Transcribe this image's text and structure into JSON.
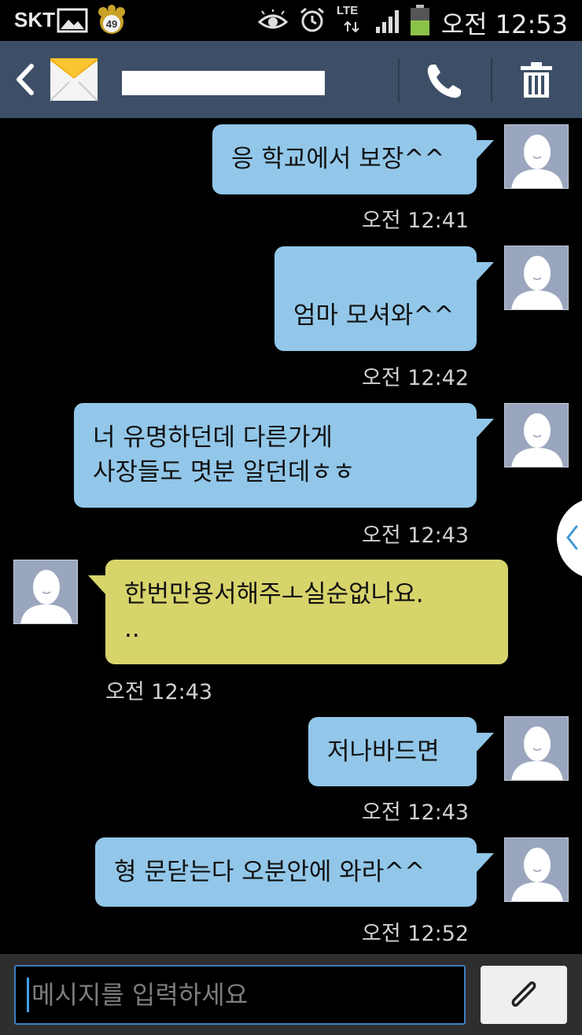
{
  "status_bar": {
    "carrier": "SKT",
    "badge_number": "49",
    "network": "LTE",
    "time": "오전 12:53",
    "icons": [
      "gallery-icon",
      "paw-badge-icon",
      "eye-icon",
      "alarm-icon",
      "lte-arrows-icon",
      "signal-icon",
      "battery-icon"
    ]
  },
  "header": {
    "contact_name": "",
    "icons": [
      "back-icon",
      "envelope-icon",
      "phone-icon",
      "trash-icon"
    ]
  },
  "messages": [
    {
      "direction": "sent",
      "lines": [
        "응 학교에서 보장^^"
      ],
      "time": "오전 12:41"
    },
    {
      "direction": "sent",
      "lines": [
        "",
        "엄마 모셔와^^"
      ],
      "time": "오전 12:42"
    },
    {
      "direction": "sent",
      "lines": [
        "너 유명하던데 다른가게",
        "사장들도 몃분 알던데ㅎㅎ"
      ],
      "time": "오전 12:43"
    },
    {
      "direction": "received",
      "lines": [
        "한번만용서해주ㅗ실순없나요.",
        ".."
      ],
      "time": "오전 12:43"
    },
    {
      "direction": "sent",
      "lines": [
        "저나바드면"
      ],
      "time": "오전 12:43"
    },
    {
      "direction": "sent",
      "lines": [
        "형 문닫는다 오분안에 와라^^"
      ],
      "time": "오전 12:52"
    }
  ],
  "composer": {
    "placeholder": "메시지를 입력하세요",
    "attach_icon": "paperclip-icon"
  },
  "colors": {
    "header_bg": "#3d4f66",
    "sent_bubble": "#92c7e9",
    "received_bubble": "#d8d46c",
    "input_border": "#3e7fbf"
  }
}
